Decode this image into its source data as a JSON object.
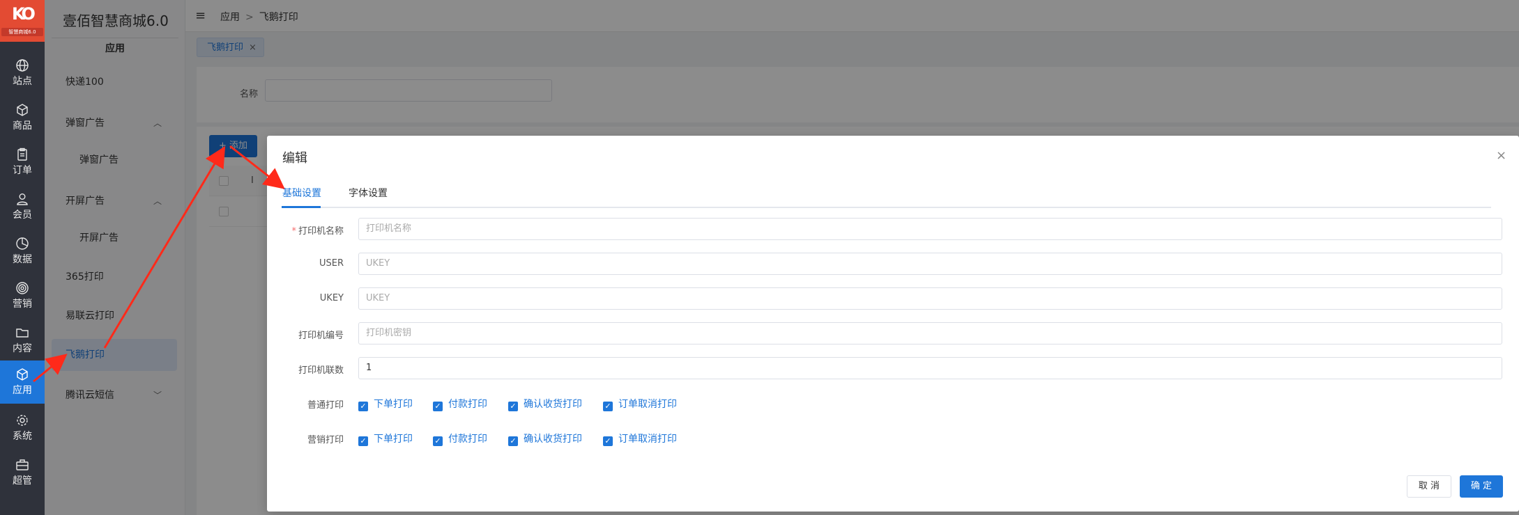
{
  "app": {
    "logo_text": "智慧商城6.0",
    "brand_title": "壹佰智慧商城6.0"
  },
  "rail": [
    {
      "label": "站点",
      "icon": "globe-icon"
    },
    {
      "label": "商品",
      "icon": "box-icon"
    },
    {
      "label": "订单",
      "icon": "clipboard-icon"
    },
    {
      "label": "会员",
      "icon": "user-icon"
    },
    {
      "label": "数据",
      "icon": "pie-chart-icon"
    },
    {
      "label": "营销",
      "icon": "target-icon"
    },
    {
      "label": "内容",
      "icon": "folder-icon"
    },
    {
      "label": "应用",
      "icon": "cube-icon",
      "active": true
    },
    {
      "label": "系统",
      "icon": "gear-icon"
    },
    {
      "label": "超管",
      "icon": "briefcase-icon"
    }
  ],
  "sidebar": {
    "section": "应用",
    "items": [
      {
        "label": "快递100"
      },
      {
        "label": "弹窗广告",
        "chevron": "︿"
      },
      {
        "label": "弹窗广告"
      },
      {
        "label": "开屏广告",
        "chevron": "︿"
      },
      {
        "label": "开屏广告"
      },
      {
        "label": "365打印"
      },
      {
        "label": "易联云打印"
      },
      {
        "label": "飞鹅打印",
        "active": true
      },
      {
        "label": "腾讯云短信",
        "chevron": "﹀"
      }
    ]
  },
  "header": {
    "menu_icon": "≡",
    "breadcrumb": [
      "应用",
      "飞鹅打印"
    ],
    "separator": ">"
  },
  "tabs": {
    "active_tab": "飞鹅打印",
    "close": "×"
  },
  "search": {
    "label": "名称"
  },
  "list": {
    "add_label": "+ 添加",
    "column_partial": "I"
  },
  "modal": {
    "title": "编辑",
    "close": "×",
    "tabs": [
      "基础设置",
      "字体设置"
    ],
    "fields": [
      {
        "label": "打印机名称",
        "required": "*",
        "placeholder": "打印机名称",
        "value": ""
      },
      {
        "label": "USER",
        "placeholder": "UKEY",
        "value": ""
      },
      {
        "label": "UKEY",
        "placeholder": "UKEY",
        "value": ""
      },
      {
        "label": "打印机编号",
        "placeholder": "打印机密钥",
        "value": ""
      },
      {
        "label": "打印机联数",
        "placeholder": "",
        "value": "1"
      }
    ],
    "checkbox_groups": [
      {
        "label": "普通打印",
        "options": [
          "下单打印",
          "付款打印",
          "确认收货打印",
          "订单取消打印"
        ]
      },
      {
        "label": "营销打印",
        "options": [
          "下单打印",
          "付款打印",
          "确认收货打印",
          "订单取消打印"
        ]
      }
    ],
    "check_mark": "✓",
    "cancel_label": "取 消",
    "ok_label": "确 定"
  },
  "colors": {
    "accent": "#1e76d9",
    "rail_bg": "#2f323b",
    "logo_bg": "#e34b33",
    "annotation_arrow": "#ff2a1a"
  }
}
